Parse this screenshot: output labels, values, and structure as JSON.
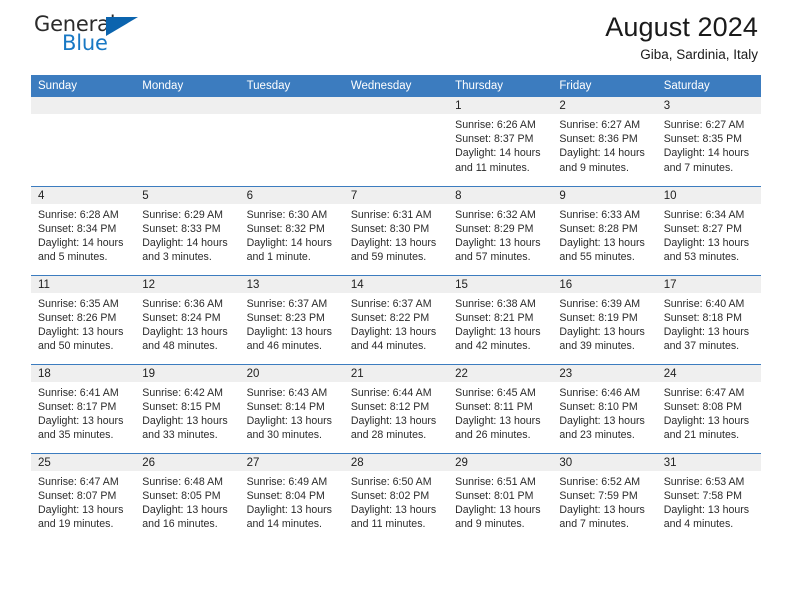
{
  "brand": {
    "name_part1": "General",
    "name_part2": "Blue"
  },
  "header": {
    "title": "August 2024",
    "subtitle": "Giba, Sardinia, Italy"
  },
  "colors": {
    "header_blue": "#3c7cbf",
    "brand_blue": "#1878c4",
    "daynum_band": "#efefef"
  },
  "weekdays": [
    "Sunday",
    "Monday",
    "Tuesday",
    "Wednesday",
    "Thursday",
    "Friday",
    "Saturday"
  ],
  "weeks": [
    [
      {
        "day": "",
        "lines": []
      },
      {
        "day": "",
        "lines": []
      },
      {
        "day": "",
        "lines": []
      },
      {
        "day": "",
        "lines": []
      },
      {
        "day": "1",
        "lines": [
          "Sunrise: 6:26 AM",
          "Sunset: 8:37 PM",
          "Daylight: 14 hours",
          "and 11 minutes."
        ]
      },
      {
        "day": "2",
        "lines": [
          "Sunrise: 6:27 AM",
          "Sunset: 8:36 PM",
          "Daylight: 14 hours",
          "and 9 minutes."
        ]
      },
      {
        "day": "3",
        "lines": [
          "Sunrise: 6:27 AM",
          "Sunset: 8:35 PM",
          "Daylight: 14 hours",
          "and 7 minutes."
        ]
      }
    ],
    [
      {
        "day": "4",
        "lines": [
          "Sunrise: 6:28 AM",
          "Sunset: 8:34 PM",
          "Daylight: 14 hours",
          "and 5 minutes."
        ]
      },
      {
        "day": "5",
        "lines": [
          "Sunrise: 6:29 AM",
          "Sunset: 8:33 PM",
          "Daylight: 14 hours",
          "and 3 minutes."
        ]
      },
      {
        "day": "6",
        "lines": [
          "Sunrise: 6:30 AM",
          "Sunset: 8:32 PM",
          "Daylight: 14 hours",
          "and 1 minute."
        ]
      },
      {
        "day": "7",
        "lines": [
          "Sunrise: 6:31 AM",
          "Sunset: 8:30 PM",
          "Daylight: 13 hours",
          "and 59 minutes."
        ]
      },
      {
        "day": "8",
        "lines": [
          "Sunrise: 6:32 AM",
          "Sunset: 8:29 PM",
          "Daylight: 13 hours",
          "and 57 minutes."
        ]
      },
      {
        "day": "9",
        "lines": [
          "Sunrise: 6:33 AM",
          "Sunset: 8:28 PM",
          "Daylight: 13 hours",
          "and 55 minutes."
        ]
      },
      {
        "day": "10",
        "lines": [
          "Sunrise: 6:34 AM",
          "Sunset: 8:27 PM",
          "Daylight: 13 hours",
          "and 53 minutes."
        ]
      }
    ],
    [
      {
        "day": "11",
        "lines": [
          "Sunrise: 6:35 AM",
          "Sunset: 8:26 PM",
          "Daylight: 13 hours",
          "and 50 minutes."
        ]
      },
      {
        "day": "12",
        "lines": [
          "Sunrise: 6:36 AM",
          "Sunset: 8:24 PM",
          "Daylight: 13 hours",
          "and 48 minutes."
        ]
      },
      {
        "day": "13",
        "lines": [
          "Sunrise: 6:37 AM",
          "Sunset: 8:23 PM",
          "Daylight: 13 hours",
          "and 46 minutes."
        ]
      },
      {
        "day": "14",
        "lines": [
          "Sunrise: 6:37 AM",
          "Sunset: 8:22 PM",
          "Daylight: 13 hours",
          "and 44 minutes."
        ]
      },
      {
        "day": "15",
        "lines": [
          "Sunrise: 6:38 AM",
          "Sunset: 8:21 PM",
          "Daylight: 13 hours",
          "and 42 minutes."
        ]
      },
      {
        "day": "16",
        "lines": [
          "Sunrise: 6:39 AM",
          "Sunset: 8:19 PM",
          "Daylight: 13 hours",
          "and 39 minutes."
        ]
      },
      {
        "day": "17",
        "lines": [
          "Sunrise: 6:40 AM",
          "Sunset: 8:18 PM",
          "Daylight: 13 hours",
          "and 37 minutes."
        ]
      }
    ],
    [
      {
        "day": "18",
        "lines": [
          "Sunrise: 6:41 AM",
          "Sunset: 8:17 PM",
          "Daylight: 13 hours",
          "and 35 minutes."
        ]
      },
      {
        "day": "19",
        "lines": [
          "Sunrise: 6:42 AM",
          "Sunset: 8:15 PM",
          "Daylight: 13 hours",
          "and 33 minutes."
        ]
      },
      {
        "day": "20",
        "lines": [
          "Sunrise: 6:43 AM",
          "Sunset: 8:14 PM",
          "Daylight: 13 hours",
          "and 30 minutes."
        ]
      },
      {
        "day": "21",
        "lines": [
          "Sunrise: 6:44 AM",
          "Sunset: 8:12 PM",
          "Daylight: 13 hours",
          "and 28 minutes."
        ]
      },
      {
        "day": "22",
        "lines": [
          "Sunrise: 6:45 AM",
          "Sunset: 8:11 PM",
          "Daylight: 13 hours",
          "and 26 minutes."
        ]
      },
      {
        "day": "23",
        "lines": [
          "Sunrise: 6:46 AM",
          "Sunset: 8:10 PM",
          "Daylight: 13 hours",
          "and 23 minutes."
        ]
      },
      {
        "day": "24",
        "lines": [
          "Sunrise: 6:47 AM",
          "Sunset: 8:08 PM",
          "Daylight: 13 hours",
          "and 21 minutes."
        ]
      }
    ],
    [
      {
        "day": "25",
        "lines": [
          "Sunrise: 6:47 AM",
          "Sunset: 8:07 PM",
          "Daylight: 13 hours",
          "and 19 minutes."
        ]
      },
      {
        "day": "26",
        "lines": [
          "Sunrise: 6:48 AM",
          "Sunset: 8:05 PM",
          "Daylight: 13 hours",
          "and 16 minutes."
        ]
      },
      {
        "day": "27",
        "lines": [
          "Sunrise: 6:49 AM",
          "Sunset: 8:04 PM",
          "Daylight: 13 hours",
          "and 14 minutes."
        ]
      },
      {
        "day": "28",
        "lines": [
          "Sunrise: 6:50 AM",
          "Sunset: 8:02 PM",
          "Daylight: 13 hours",
          "and 11 minutes."
        ]
      },
      {
        "day": "29",
        "lines": [
          "Sunrise: 6:51 AM",
          "Sunset: 8:01 PM",
          "Daylight: 13 hours",
          "and 9 minutes."
        ]
      },
      {
        "day": "30",
        "lines": [
          "Sunrise: 6:52 AM",
          "Sunset: 7:59 PM",
          "Daylight: 13 hours",
          "and 7 minutes."
        ]
      },
      {
        "day": "31",
        "lines": [
          "Sunrise: 6:53 AM",
          "Sunset: 7:58 PM",
          "Daylight: 13 hours",
          "and 4 minutes."
        ]
      }
    ]
  ]
}
